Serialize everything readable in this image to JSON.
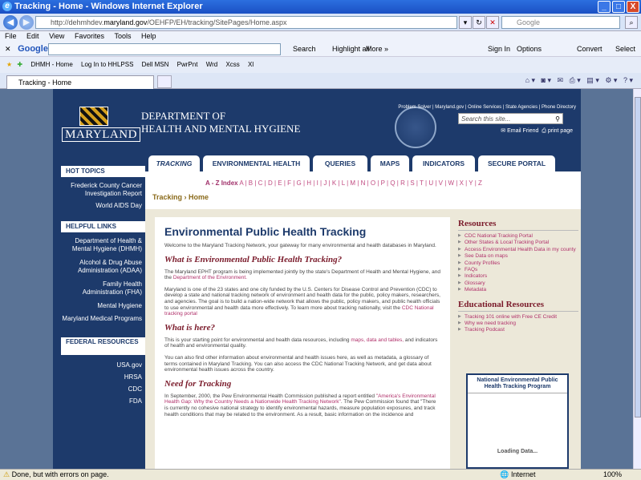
{
  "window": {
    "title": "Tracking - Home - Windows Internet Explorer",
    "controls": {
      "minimize": "_",
      "maximize": "□",
      "close": "X"
    }
  },
  "address": {
    "url_prefix": "http://dehmhdev.",
    "url_host": "maryland.gov",
    "url_path": "/OEHFP/EH/tracking/SitePages/Home.aspx",
    "search_placeholder": "Google"
  },
  "menubar": [
    "File",
    "Edit",
    "View",
    "Favorites",
    "Tools",
    "Help"
  ],
  "googlebar": {
    "label": "Google",
    "search": "Search",
    "highlight": "Highlight all",
    "more": "More »",
    "signin": "Sign In",
    "options": "Options",
    "convert": "Convert",
    "select": "Select"
  },
  "favorites": [
    "DHMH - Home",
    "Log In to HHLPSS",
    "Dell MSN",
    "PwrPnt",
    "Wrd",
    "Xcss",
    "Xl"
  ],
  "tab": {
    "label": "Tracking - Home"
  },
  "site": {
    "logo_text": "MARYLAND",
    "dept_line1": "DEPARTMENT OF",
    "dept_line2": "HEALTH AND MENTAL HYGIENE",
    "top_links": "Problem Solver | Maryland.gov | Online Services | State Agencies | Phone Directory",
    "search_placeholder": "Search this site...",
    "email_friend": "Email Friend",
    "print_page": "print page"
  },
  "left_nav": {
    "hot_topics": {
      "title": "HOT TOPICS",
      "items": [
        "Frederick County Cancer Investigation Report",
        "World AIDS Day"
      ]
    },
    "helpful_links": {
      "title": "HELPFUL LINKS",
      "items": [
        "Department of Health & Mental Hygiene (DHMH)",
        "Alcohol & Drug Abuse Administration (ADAA)",
        "Family Health Administration (FHA)",
        "Mental Hygiene",
        "Maryland Medical Programs"
      ]
    },
    "federal": {
      "title": "FEDERAL RESOURCES",
      "items": [
        "USA.gov",
        "HRSA",
        "CDC",
        "FDA"
      ]
    }
  },
  "nav_tabs": [
    "TRACKING",
    "ENVIRONMENTAL HEALTH",
    "QUERIES",
    "MAPS",
    "INDICATORS",
    "SECURE PORTAL"
  ],
  "az_index": {
    "label": "A - Z Index",
    "letters": "A | B | C | D | E | F | G | H | I | J | K | L | M | N | O | P | Q | R | S | T | U | V | W | X | Y | Z"
  },
  "breadcrumb": {
    "parent": "Tracking",
    "separator": "›",
    "current": "Home"
  },
  "main": {
    "title": "Environmental Public Health Tracking",
    "intro": "Welcome to the Maryland Tracking Network, your gateway for many environmental and health databases in Maryland.",
    "what_is": {
      "heading": "What is Environmental Public Health Tracking?",
      "p1_a": "The Maryland EPHT program is being implemented jointly by the state's Department of Health and Mental Hygiene, and the ",
      "p1_link": "Department of the Environment.",
      "p2_a": "Maryland is one of the 23 states and one city funded by the U.S. Centers for Disease Control and Prevention (CDC) to develop a state and national tracking network of environment and health data for the public, policy makers, researchers, and agencies. The goal is to build a nation-wide network that allows the public, policy makers, and public health officials to use environmental and health data more effectively. To learn more about tracking nationally, visit the ",
      "p2_link": "CDC National tracking portal"
    },
    "what_here": {
      "heading": "What is here?",
      "p1_a": "This is your starting point for environmental and health data resources, including ",
      "p1_link": "maps, data and tables,",
      "p1_b": " and indicators of health and environmental quality.",
      "p2": "You can also find other information about environmental and health issues here, as well as metadata, a glossary of terms contained in Maryland Tracking. You can also access the CDC National Tracking Network, and get data about environmental health issues across the country."
    },
    "need": {
      "heading": "Need for Tracking",
      "p1_a": "In September, 2000, the Pew Environmental Health Commission published a report entitled ",
      "p1_link": "\"America's Environmental Health Gap: Why the Country Needs a Nationwide Health Tracking Network\"",
      "p1_b": ". The Pew Commission found that \"There is currently no cohesive national strategy to identify environmental hazards, measure population exposures, and track health conditions that may be related to the environment. As a result, basic information on the incidence and"
    }
  },
  "resources": {
    "title": "Resources",
    "items": [
      "CDC National Tracking Portal",
      "Other States & Local Tracking Portal",
      "Access Environmental Health Data in my county",
      "See Data on maps",
      "County Profiles",
      "FAQs",
      "Indicators",
      "Glossary",
      "Metadata"
    ]
  },
  "edu": {
    "title": "Educational Resources",
    "items": [
      "Tracking 101 online with Free CE Credit",
      "Why we need tracking",
      "Tracking Podcast"
    ]
  },
  "widget": {
    "title": "National Environmental Public Health Tracking Program",
    "loading": "Loading Data..."
  },
  "status": {
    "text": "Done, but with errors on page.",
    "zone": "Internet",
    "zoom": "100%"
  }
}
